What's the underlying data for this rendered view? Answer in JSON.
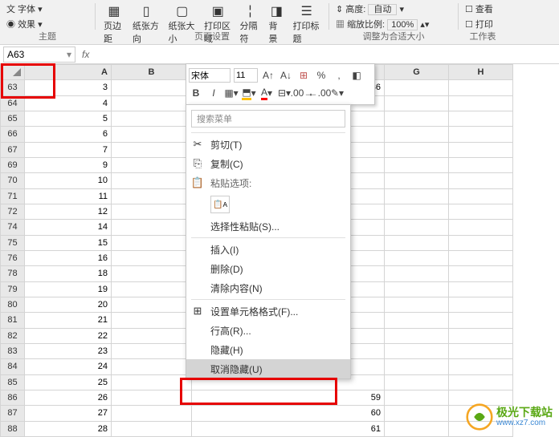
{
  "ribbon": {
    "font_btn": "文 字体",
    "effects_btn": "效果",
    "theme_label": "主题",
    "page_margin": "页边距",
    "orientation": "纸张方向",
    "paper_size": "纸张大小",
    "print_area": "打印区域",
    "breaks": "分隔符",
    "background": "背景",
    "print_titles": "打印标题",
    "page_setup_label": "页面设置",
    "height_label": "高度:",
    "height_val": "自动",
    "scale_label": "缩放比例:",
    "scale_val": "100%",
    "fit_label": "调整为合适大小",
    "view_check": "查看",
    "print_check": "打印",
    "sheet_label": "工作表"
  },
  "namebox": "A63",
  "columns": [
    "A",
    "B",
    "G",
    "H"
  ],
  "rows": [
    {
      "n": "63",
      "a": "3",
      "d": "36"
    },
    {
      "n": "64",
      "a": "4"
    },
    {
      "n": "65",
      "a": "5"
    },
    {
      "n": "66",
      "a": "6"
    },
    {
      "n": "67",
      "a": "7"
    },
    {
      "n": "69",
      "a": "9"
    },
    {
      "n": "70",
      "a": "10"
    },
    {
      "n": "71",
      "a": "11"
    },
    {
      "n": "72",
      "a": "12"
    },
    {
      "n": "74",
      "a": "14"
    },
    {
      "n": "75",
      "a": "15"
    },
    {
      "n": "76",
      "a": "16"
    },
    {
      "n": "78",
      "a": "18"
    },
    {
      "n": "79",
      "a": "19"
    },
    {
      "n": "80",
      "a": "20"
    },
    {
      "n": "81",
      "a": "21"
    },
    {
      "n": "82",
      "a": "22"
    },
    {
      "n": "83",
      "a": "23"
    },
    {
      "n": "84",
      "a": "24"
    },
    {
      "n": "85",
      "a": "25"
    },
    {
      "n": "86",
      "a": "26",
      "d": "59"
    },
    {
      "n": "87",
      "a": "27",
      "d": "60"
    },
    {
      "n": "88",
      "a": "28",
      "d": "61"
    }
  ],
  "mini": {
    "font": "宋体",
    "size": "11",
    "btns": [
      "B",
      "I"
    ]
  },
  "menu": {
    "search_placeholder": "搜索菜单",
    "cut": "剪切(T)",
    "copy": "复制(C)",
    "paste_options": "粘贴选项:",
    "paste_special": "选择性粘贴(S)...",
    "insert": "插入(I)",
    "delete": "删除(D)",
    "clear": "清除内容(N)",
    "format_cells": "设置单元格格式(F)...",
    "row_height": "行高(R)...",
    "hide": "隐藏(H)",
    "unhide": "取消隐藏(U)"
  },
  "watermark": {
    "cn": "极光下载站",
    "url": "www.xz7.com"
  }
}
